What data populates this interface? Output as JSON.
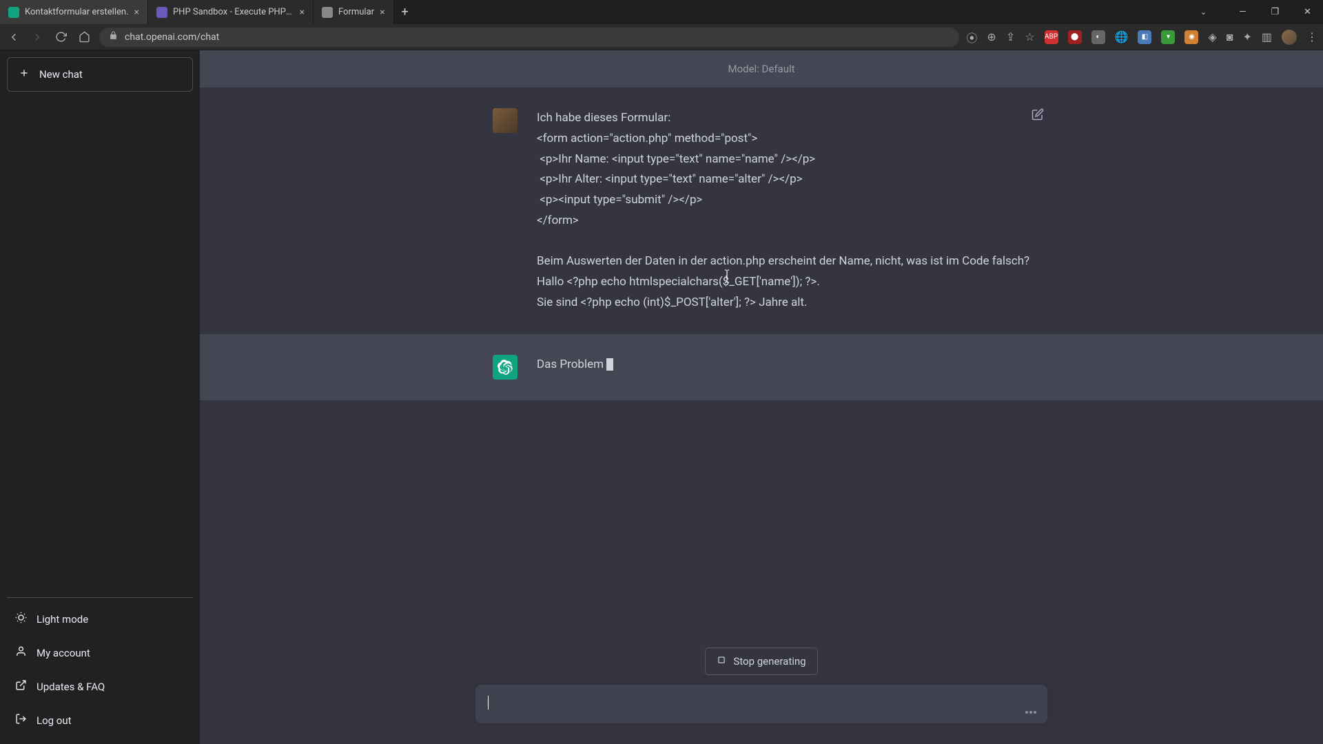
{
  "browser": {
    "tabs": [
      {
        "title": "Kontaktformular erstellen.",
        "active": true,
        "fav": "green"
      },
      {
        "title": "PHP Sandbox - Execute PHP cod",
        "active": false,
        "fav": "purple"
      },
      {
        "title": "Formular",
        "active": false,
        "fav": "gray"
      }
    ],
    "url": "chat.openai.com/chat"
  },
  "sidebar": {
    "new_chat": "New chat",
    "light_mode": "Light mode",
    "my_account": "My account",
    "updates_faq": "Updates & FAQ",
    "log_out": "Log out"
  },
  "model_bar": "Model: Default",
  "messages": {
    "user": "Ich habe dieses Formular:\n<form action=\"action.php\" method=\"post\">\n <p>Ihr Name: <input type=\"text\" name=\"name\" /></p>\n <p>Ihr Alter: <input type=\"text\" name=\"alter\" /></p>\n <p><input type=\"submit\" /></p>\n</form>\n\nBeim Auswerten der Daten in der action.php erscheint der Name, nicht, was ist im Code falsch?\nHallo <?php echo htmlspecialchars($_GET['name']); ?>.\nSie sind <?php echo (int)$_POST['alter']; ?> Jahre alt.",
    "assistant": "Das Problem"
  },
  "controls": {
    "stop_generating": "Stop generating"
  }
}
